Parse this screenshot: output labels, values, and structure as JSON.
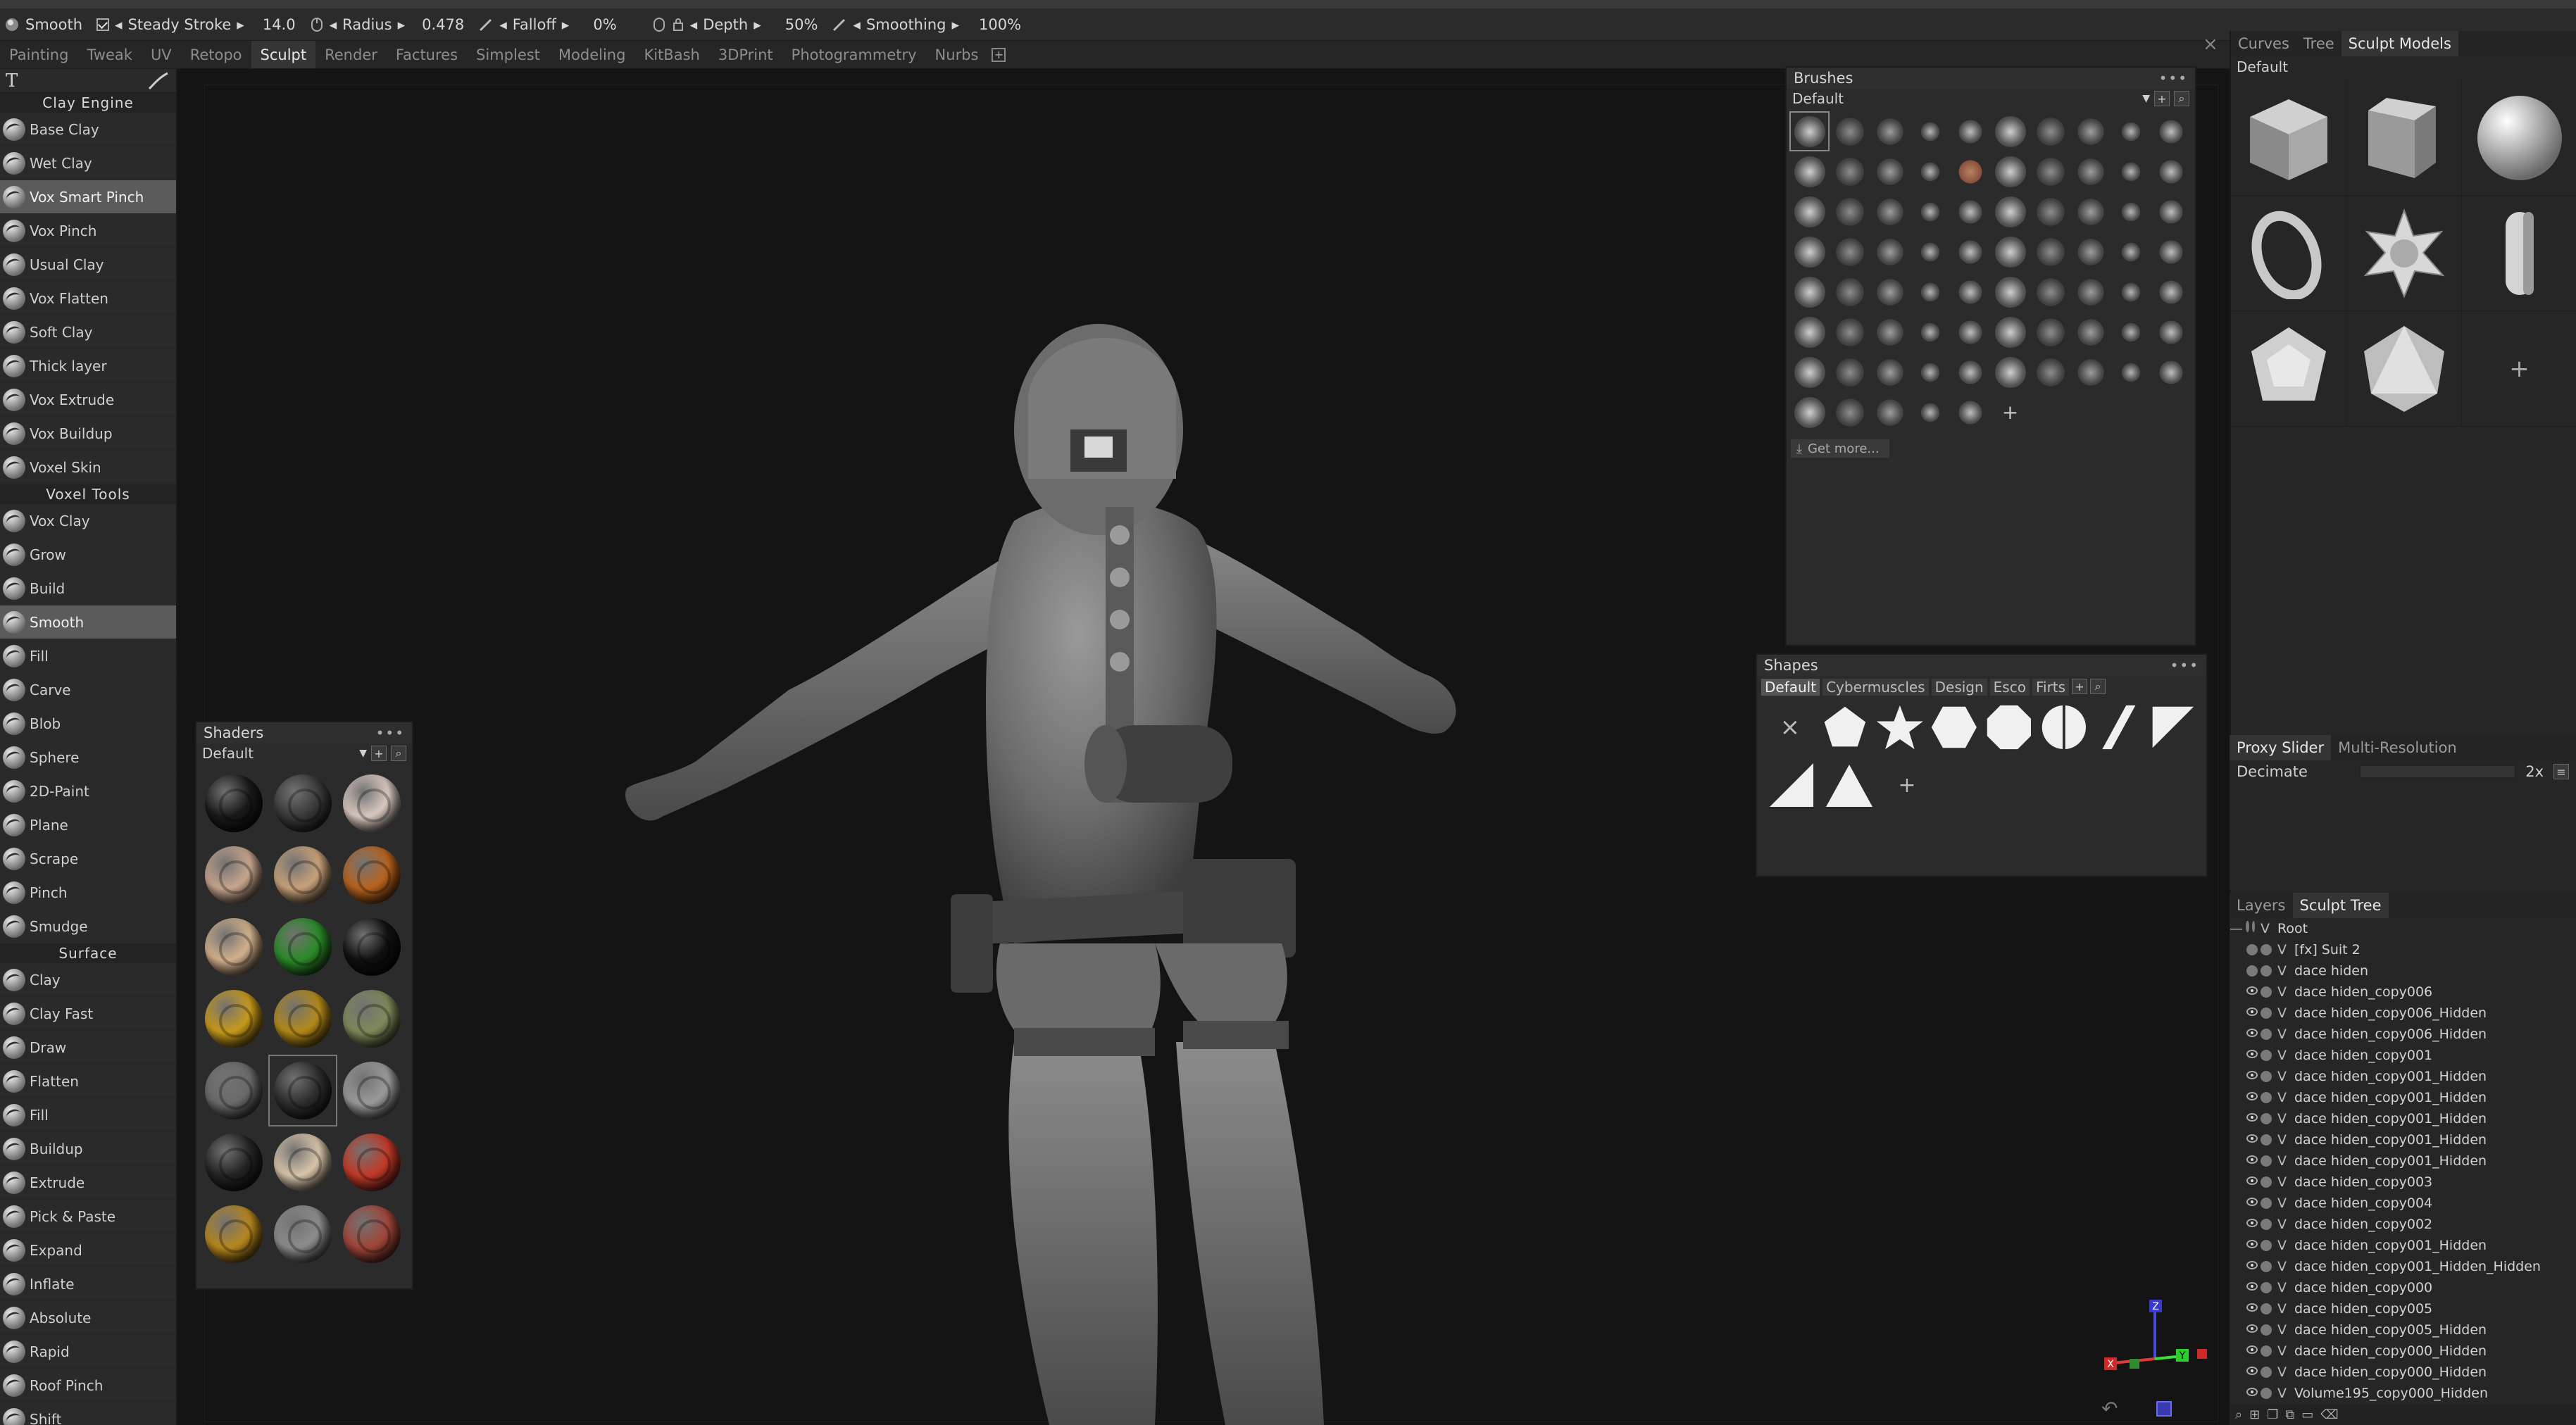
{
  "toolbar": {
    "tool_name": "Smooth",
    "steady_stroke_label": "Steady Stroke",
    "steady_stroke_value": "14.0",
    "radius_label": "Radius",
    "radius_value": "0.478",
    "falloff_label": "Falloff",
    "falloff_value": "0%",
    "depth_label": "Depth",
    "depth_value": "50%",
    "smoothing_label": "Smoothing",
    "smoothing_value": "100%"
  },
  "rooms": [
    "Painting",
    "Tweak",
    "UV",
    "Retopo",
    "Sculpt",
    "Render",
    "Factures",
    "Simplest",
    "Modeling",
    "KitBash",
    "3DPrint",
    "Photogrammetry",
    "Nurbs"
  ],
  "active_room": "Sculpt",
  "left_panel": {
    "text_tool_glyph": "T",
    "sections": [
      {
        "title": "Clay Engine",
        "tools": [
          "Base Clay",
          "Wet Clay",
          "Vox Smart Pinch",
          "Vox Pinch",
          "Usual Clay",
          "Vox Flatten",
          "Soft Clay",
          "Thick layer",
          "Vox Extrude",
          "Vox Buildup",
          "Voxel Skin"
        ]
      },
      {
        "title": "Voxel Tools",
        "tools": [
          "Vox Clay",
          "Grow",
          "Build",
          "Smooth",
          "Fill",
          "Carve",
          "Blob",
          "Sphere",
          "2D-Paint",
          "Plane",
          "Scrape",
          "Pinch",
          "Smudge"
        ]
      },
      {
        "title": "Surface",
        "tools": [
          "Clay",
          "Clay Fast",
          "Draw",
          "Flatten",
          "Fill",
          "Buildup",
          "Extrude",
          "Pick & Paste",
          "Expand",
          "Inflate",
          "Absolute",
          "Rapid",
          "Roof Pinch",
          "Shift"
        ]
      }
    ],
    "active_tools": [
      "Vox Smart Pinch",
      "Smooth"
    ]
  },
  "shaders_panel": {
    "title": "Shaders",
    "preset": "Default",
    "colors": [
      "#1a1a1a",
      "#3a3a3a",
      "#d9c8bf",
      "#c7a58e",
      "#c9a27a",
      "#b8631f",
      "#d2b08c",
      "#2c8a2a",
      "#111111",
      "#c79a1d",
      "#b38a1a",
      "#7d8a5a",
      "#6a6a6a",
      "#2e2e2e",
      "#9a9a9a",
      "#242424",
      "#d8c4aa",
      "#c23a2a",
      "#b6871f",
      "#8c8c8c",
      "#a0463a"
    ],
    "selected_index": 13
  },
  "brushes_panel": {
    "title": "Brushes",
    "preset": "Default",
    "get_more_label": "Get more..."
  },
  "shapes_panel": {
    "title": "Shapes",
    "tabs": [
      "Default",
      "Cybermuscles",
      "Design",
      "Esco",
      "Firts"
    ],
    "active_tab": "Default"
  },
  "right_tabs": [
    "Curves",
    "Tree",
    "Sculpt Models"
  ],
  "right_active_tab": "Sculpt Models",
  "models_preset": "Default",
  "proxy": {
    "tabs": [
      "Proxy Slider",
      "Multi-Resolution"
    ],
    "active_tab": "Proxy Slider",
    "decimate_label": "Decimate",
    "decimate_value": "2x"
  },
  "tree": {
    "tabs": [
      "Layers",
      "Sculpt Tree"
    ],
    "active_tab": "Sculpt Tree",
    "rows": [
      "Root",
      "[fx]  Suit  2",
      "dace  hiden",
      "dace  hiden_copy006",
      "dace  hiden_copy006_Hidden",
      "dace  hiden_copy006_Hidden",
      "dace  hiden_copy001",
      "dace  hiden_copy001_Hidden",
      "dace  hiden_copy001_Hidden",
      "dace  hiden_copy001_Hidden",
      "dace  hiden_copy001_Hidden",
      "dace  hiden_copy001_Hidden",
      "dace  hiden_copy003",
      "dace  hiden_copy004",
      "dace  hiden_copy002",
      "dace  hiden_copy001_Hidden",
      "dace  hiden_copy001_Hidden_Hidden",
      "dace  hiden_copy000",
      "dace  hiden_copy005",
      "dace  hiden_copy005_Hidden",
      "dace  hiden_copy000_Hidden",
      "dace  hiden_copy000_Hidden",
      "Volume195_copy000_Hidden"
    ]
  },
  "gizmo": {
    "x_label": "X",
    "y_label": "Y",
    "z_label": "Z"
  }
}
